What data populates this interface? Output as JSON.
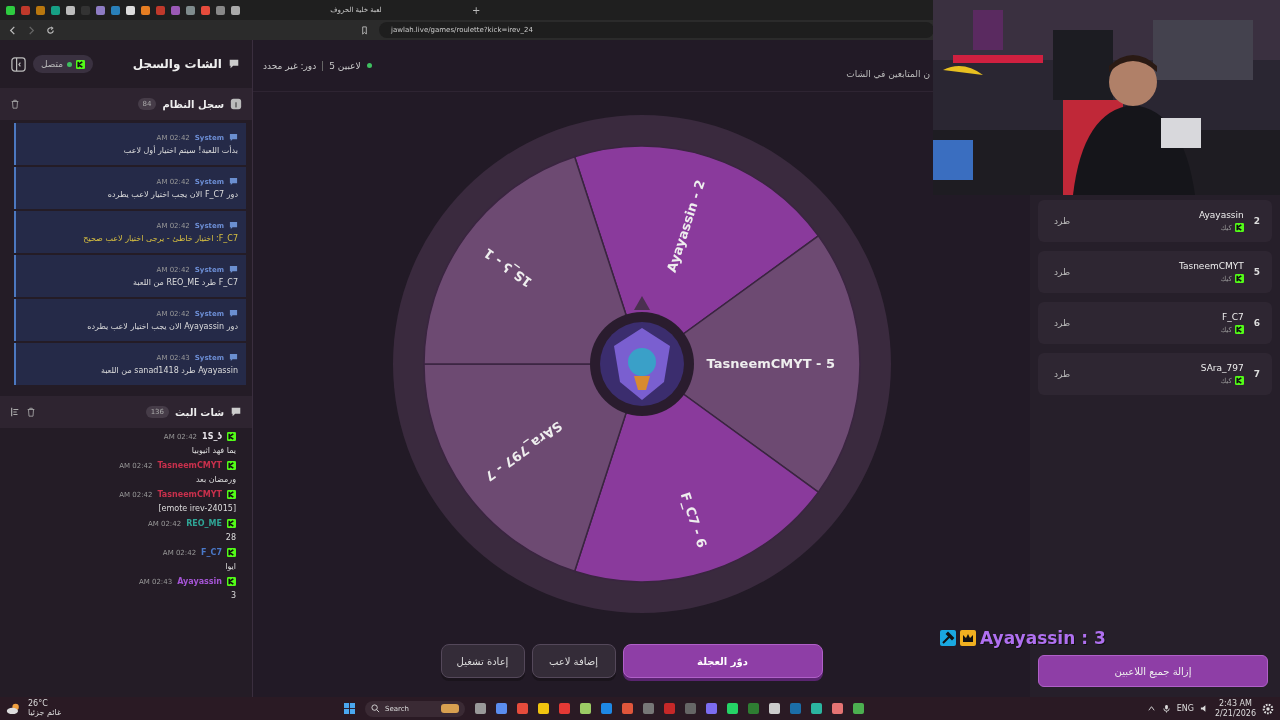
{
  "browser": {
    "tab_title": "لعبة خلية الحروف",
    "new_tab": "+",
    "url": "jawlah.live/games/roulette?kick=irev_24"
  },
  "sidebar": {
    "title": "الشات والسجل",
    "status": "متصل",
    "system_log": {
      "title": "سجل النظام",
      "count": "84",
      "messages": [
        {
          "sender": "System",
          "time": "AM 02:42",
          "text": "بدأت اللعبة! سيتم اختيار أول لاعب",
          "kind": "info"
        },
        {
          "sender": "System",
          "time": "AM 02:42",
          "text": "دور F_C7 الان يجب اختيار لاعب يطرده",
          "kind": "info"
        },
        {
          "sender": "System",
          "time": "AM 02:42",
          "text": "F_C7: اختيار خاطئ - يرجى اختيار لاعب صحيح",
          "kind": "warning"
        },
        {
          "sender": "System",
          "time": "AM 02:42",
          "text": "F_C7 طرد REO_ME من اللعبة",
          "kind": "info"
        },
        {
          "sender": "System",
          "time": "AM 02:42",
          "text": "دور Ayayassin الان يجب اختيار لاعب يطرده",
          "kind": "info"
        },
        {
          "sender": "System",
          "time": "AM 02:43",
          "text": "Ayayassin طرد sanad1418 من اللعبة",
          "kind": "info"
        }
      ]
    },
    "chat": {
      "title": "شات البث",
      "count": "136",
      "messages": [
        {
          "user": "1S_ʖ",
          "color": "#e8e4ea",
          "time": "AM 02:42",
          "text": "يما فهد اثيوبيا"
        },
        {
          "user": "TasneemCMYT",
          "color": "#c8304c",
          "time": "AM 02:42",
          "text": "ورمضان بعد"
        },
        {
          "user": "TasneemCMYT",
          "color": "#c8304c",
          "time": "AM 02:42",
          "text": "[emote irev-24015]"
        },
        {
          "user": "REO_ME",
          "color": "#2fa596",
          "time": "AM 02:42",
          "text": "28"
        },
        {
          "user": "F_C7",
          "color": "#4a78c8",
          "time": "AM 02:42",
          "text": "ايوا"
        },
        {
          "user": "Ayayassin",
          "color": "#a454d4",
          "time": "AM 02:43",
          "text": "3"
        }
      ]
    }
  },
  "game": {
    "players_count": "5 لاعبين",
    "turn": "دور: غير محدد",
    "hint": "ن المتابعين في الشات",
    "wheel": {
      "segments": [
        {
          "label": "Ayayassin - 2",
          "color": "#8a3a9c"
        },
        {
          "label": "TasneemCMYT - 5",
          "color": "#6d4a72"
        },
        {
          "label": "F_C7 - 6",
          "color": "#8a3a9c"
        },
        {
          "label": "SAra_797 - 7",
          "color": "#6d4a72"
        },
        {
          "label": "1S_ʖ - 1",
          "color": "#6d4a72"
        }
      ]
    },
    "buttons": [
      {
        "label": "دوّر العجلة",
        "kind": "primary"
      },
      {
        "label": "إضافة لاعب",
        "kind": "secondary"
      },
      {
        "label": "إعادة تشغيل",
        "kind": "secondary"
      }
    ]
  },
  "players": {
    "items": [
      {
        "number": "2",
        "name": "Ayayassin",
        "platform": "كيك",
        "action": "طرد"
      },
      {
        "number": "5",
        "name": "TasneemCMYT",
        "platform": "كيك",
        "action": "طرد"
      },
      {
        "number": "6",
        "name": "F_C7",
        "platform": "كيك",
        "action": "طرد"
      },
      {
        "number": "7",
        "name": "SAra_797",
        "platform": "كيك",
        "action": "طرد"
      }
    ],
    "clear_button": "إزالة جميع اللاعبين"
  },
  "overlay": {
    "text": "Ayayassin : 3"
  },
  "taskbar": {
    "temperature": "26°C",
    "weather": "غائم جزئيا",
    "search": "Search",
    "language": "ENG",
    "time": "2:43 AM",
    "date": "2/21/2026"
  }
}
